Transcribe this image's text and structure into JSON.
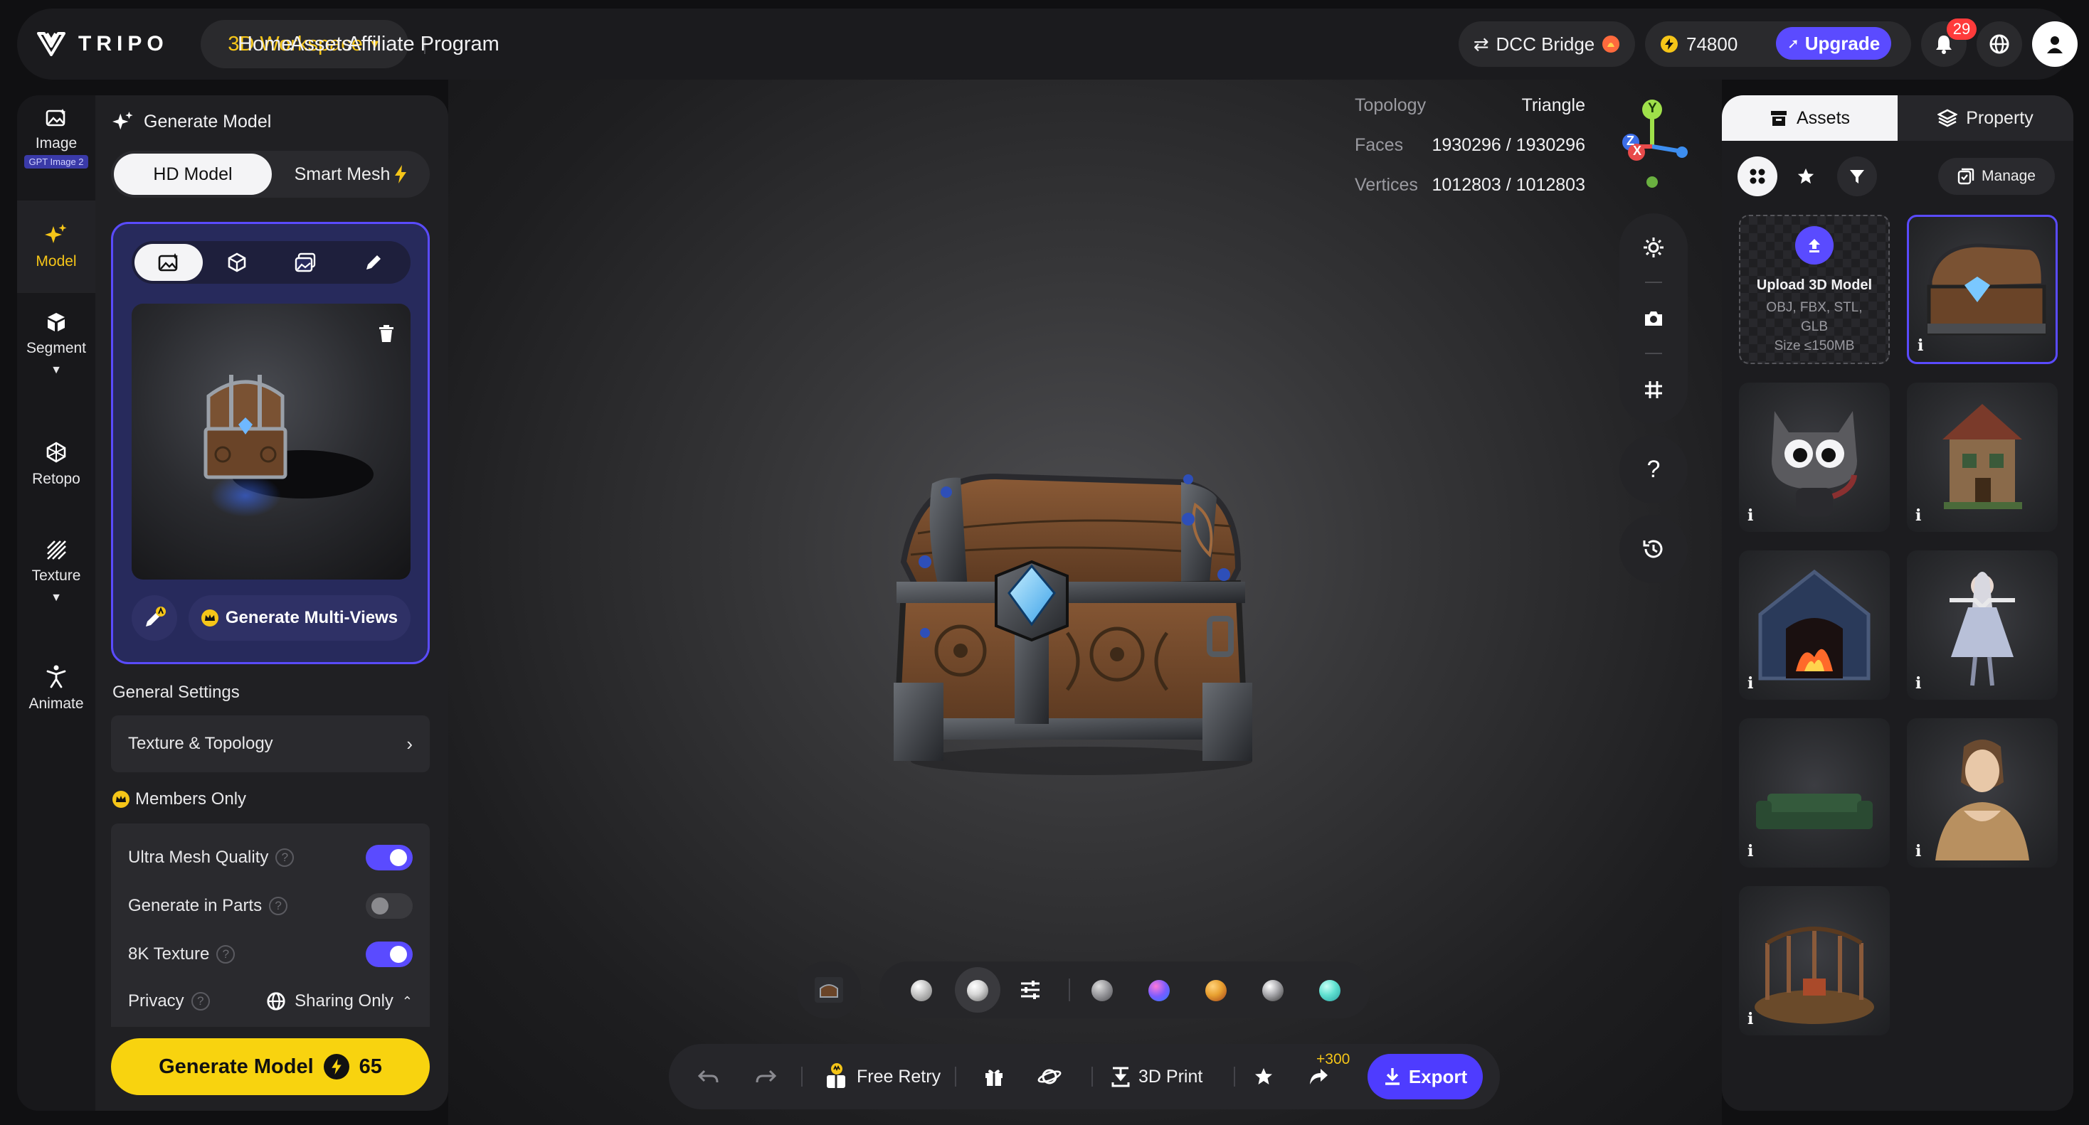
{
  "header": {
    "logo_text": "TRIPO",
    "workspace_label": "3D Workspace",
    "nav": [
      "Home",
      "Assets",
      "Affiliate Program"
    ],
    "dcc_bridge_label": "DCC Bridge",
    "credits": "74800",
    "upgrade_label": "Upgrade",
    "notification_count": "29"
  },
  "sidebar": {
    "items": [
      {
        "label": "Image",
        "tag": "GPT Image 2",
        "icon": "image-icon"
      },
      {
        "label": "Model",
        "icon": "sparkle-icon",
        "active": true
      },
      {
        "label": "Segment",
        "icon": "cube-segment-icon"
      },
      {
        "label": "Retopo",
        "icon": "retopo-icon"
      },
      {
        "label": "Texture",
        "icon": "texture-icon"
      },
      {
        "label": "Animate",
        "icon": "figure-icon"
      }
    ]
  },
  "generate_panel": {
    "title": "Generate Model",
    "mode_tabs": [
      "HD Model",
      "Smart Mesh"
    ],
    "multiview_label": "Generate Multi-Views",
    "general_settings_label": "General Settings",
    "texture_topology_label": "Texture & Topology",
    "members_only_label": "Members Only",
    "options": [
      {
        "label": "Ultra Mesh Quality",
        "on": true
      },
      {
        "label": "Generate in Parts",
        "on": false
      },
      {
        "label": "8K Texture",
        "on": true
      }
    ],
    "privacy_label": "Privacy",
    "privacy_value": "Sharing Only",
    "generate_label": "Generate Model",
    "generate_cost": "65"
  },
  "viewport": {
    "topology_key": "Topology",
    "topology_value": "Triangle",
    "faces_key": "Faces",
    "faces_value": "1930296 / 1930296",
    "vertices_key": "Vertices",
    "vertices_value": "1012803 / 1012803",
    "axis_labels": {
      "y": "Y",
      "x": "X",
      "z": "Z"
    },
    "help_label": "?",
    "material_colors": [
      "#d9d9d9",
      "#e8e8e8",
      "#9a9a9e",
      "#7b5cff",
      "#e8a030",
      "#b0b0b4",
      "#5fe0d0"
    ]
  },
  "action_bar": {
    "free_retry_label": "Free Retry",
    "print_label": "3D Print",
    "bonus_label": "+300",
    "export_label": "Export"
  },
  "assets_panel": {
    "tabs": [
      "Assets",
      "Property"
    ],
    "manage_label": "Manage",
    "upload_title": "Upload 3D Model",
    "upload_formats": "OBJ, FBX, STL, GLB",
    "upload_size": "Size ≤150MB",
    "info_label": "i",
    "items": [
      "treasure-chest",
      "cat-figure",
      "cottage",
      "fireplace",
      "fairy-figure",
      "green-sofa",
      "portrait-bust",
      "stage-scene"
    ]
  }
}
